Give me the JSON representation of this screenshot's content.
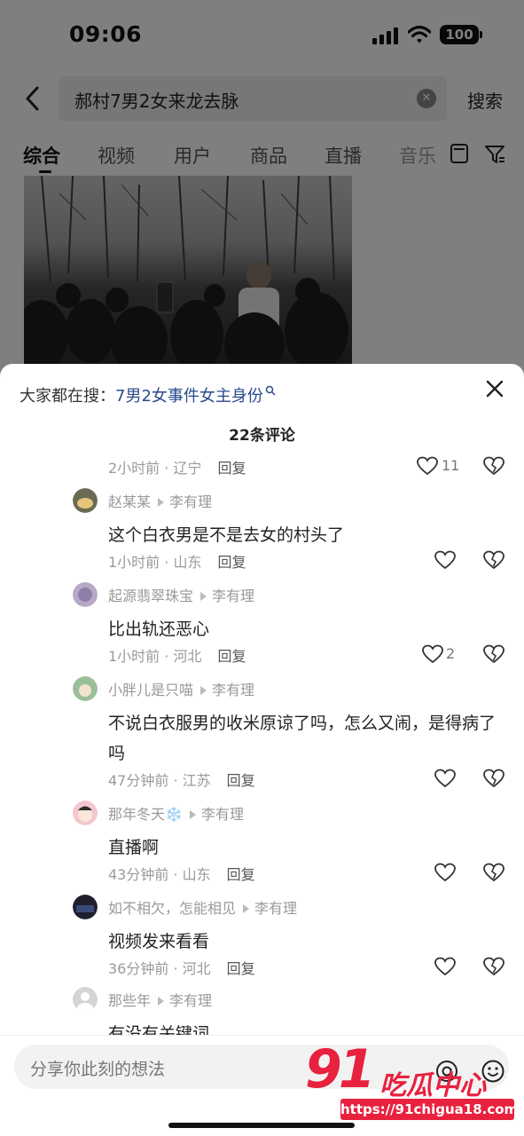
{
  "status_bar": {
    "time": "09:06",
    "battery": "100"
  },
  "search": {
    "query": "郝村7男2女来龙去脉",
    "button_label": "搜索"
  },
  "tabs": [
    {
      "label": "综合",
      "active": true
    },
    {
      "label": "视频"
    },
    {
      "label": "用户"
    },
    {
      "label": "商品"
    },
    {
      "label": "直播"
    },
    {
      "label": "音乐"
    }
  ],
  "sheet": {
    "hot_search_label": "大家都在搜：",
    "hot_search_link": "7男2女事件女主身份",
    "comment_count": "22条评论",
    "reply_label": "回复"
  },
  "top_meta": {
    "meta": "2小时前 · 辽宁",
    "likes": "11"
  },
  "comments": [
    {
      "user": "赵某某",
      "reply_to": "李有理",
      "text": "这个白衣男是不是去女的村头了",
      "meta": "1小时前 · 山东",
      "likes": ""
    },
    {
      "user": "起源翡翠珠宝",
      "reply_to": "李有理",
      "text": "比出轨还恶心",
      "meta": "1小时前 · 河北",
      "likes": "2"
    },
    {
      "user": "小胖儿是只喵",
      "reply_to": "李有理",
      "text": "不说白衣服男的收米原谅了吗，怎么又闹，是得病了吗",
      "meta": "47分钟前 · 江苏",
      "likes": ""
    },
    {
      "user": "那年冬天❄️",
      "reply_to": "李有理",
      "text": "直播啊",
      "meta": "43分钟前 · 山东",
      "likes": ""
    },
    {
      "user": "如不相欠，怎能相见",
      "reply_to": "李有理",
      "text": "视频发来看看",
      "meta": "36分钟前 · 河北",
      "likes": ""
    },
    {
      "user": "那些年",
      "reply_to": "李有理",
      "text": "有没有关键词",
      "meta": "",
      "likes": ""
    }
  ],
  "input": {
    "placeholder": "分享你此刻的想法"
  },
  "watermark": {
    "logo": "91",
    "name": "吃瓜中心",
    "url": "https://91chigua18.com"
  },
  "colors": {
    "accent_red": "#e8213f",
    "link_blue": "#2a4a8c"
  },
  "icons": [
    "back-icon",
    "clear-icon",
    "layout-icon",
    "filter-icon",
    "close-icon",
    "heart-icon",
    "dislike-icon",
    "at-icon",
    "emoji-icon",
    "signal-icon",
    "wifi-icon"
  ]
}
